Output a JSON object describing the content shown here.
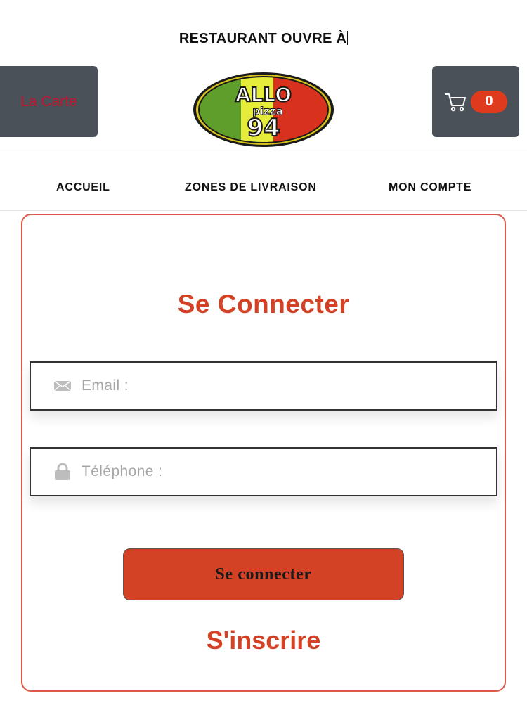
{
  "header": {
    "status_text": "RESTAURANT OUVRE À",
    "menu_button_label": "La Carte",
    "cart_count": "0",
    "logo": {
      "text_top": "ALLO",
      "text_mid": "pizza",
      "text_bottom": "94"
    }
  },
  "nav": {
    "items": [
      {
        "label": "ACCUEIL"
      },
      {
        "label": "ZONES DE LIVRAISON"
      },
      {
        "label": "MON COMPTE"
      }
    ]
  },
  "login": {
    "title": "Se Connecter",
    "email_placeholder": "Email :",
    "phone_placeholder": "Téléphone :",
    "submit_label": "Se connecter",
    "signup_label": "S'inscrire"
  },
  "colors": {
    "accent": "#d44226",
    "menu_text": "#c0152a",
    "header_button_bg": "#4a5159",
    "badge": "#e03a1c"
  },
  "icons": {
    "cart": "cart-icon",
    "email": "envelope-icon",
    "phone": "lock-icon"
  }
}
